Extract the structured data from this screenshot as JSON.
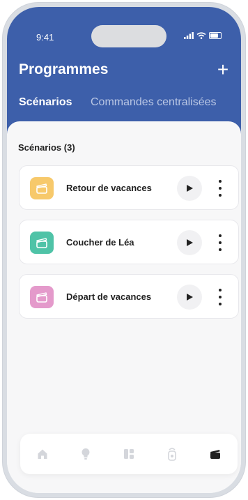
{
  "status": {
    "time": "9:41"
  },
  "header": {
    "title": "Programmes",
    "add_label": "+"
  },
  "tabs": [
    {
      "label": "Scénarios",
      "active": true
    },
    {
      "label": "Commandes centralisées",
      "active": false
    }
  ],
  "section": {
    "title": "Scénarios (3)"
  },
  "scenarios": [
    {
      "name": "Retour de vacances",
      "icon": "clapperboard-icon",
      "color": "#f7c96b"
    },
    {
      "name": "Coucher de Léa",
      "icon": "clapperboard-icon",
      "color": "#4fc3a7"
    },
    {
      "name": "Départ de vacances",
      "icon": "clapperboard-icon",
      "color": "#e49acb"
    }
  ],
  "bottom_nav": [
    {
      "icon": "home-icon",
      "active": false
    },
    {
      "icon": "lightbulb-icon",
      "active": false
    },
    {
      "icon": "dashboard-icon",
      "active": false
    },
    {
      "icon": "remote-icon",
      "active": false
    },
    {
      "icon": "clapperboard-icon",
      "active": true
    }
  ],
  "colors": {
    "brand": "#3d5faa",
    "nav_inactive": "#d4d6db",
    "nav_active": "#222222"
  }
}
